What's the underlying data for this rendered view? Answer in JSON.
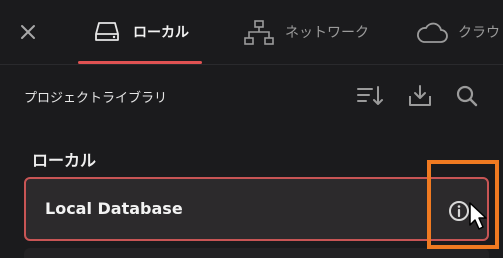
{
  "tabs": [
    {
      "label": "ローカル",
      "icon": "drive-icon",
      "active": true
    },
    {
      "label": "ネットワーク",
      "icon": "network-icon",
      "active": false
    },
    {
      "label": "クラウ",
      "icon": "cloud-icon",
      "active": false
    }
  ],
  "toolbar": {
    "title": "プロジェクトライブラリ",
    "icons": [
      "sort-icon",
      "import-icon",
      "search-icon"
    ]
  },
  "section": {
    "title": "ローカル"
  },
  "databases": [
    {
      "name": "Local Database",
      "icon": "info-icon"
    }
  ],
  "colors": {
    "background": "#1b1b1d",
    "accent": "#e05252",
    "highlight": "#f07a21",
    "item_background": "#2c2a2c"
  }
}
